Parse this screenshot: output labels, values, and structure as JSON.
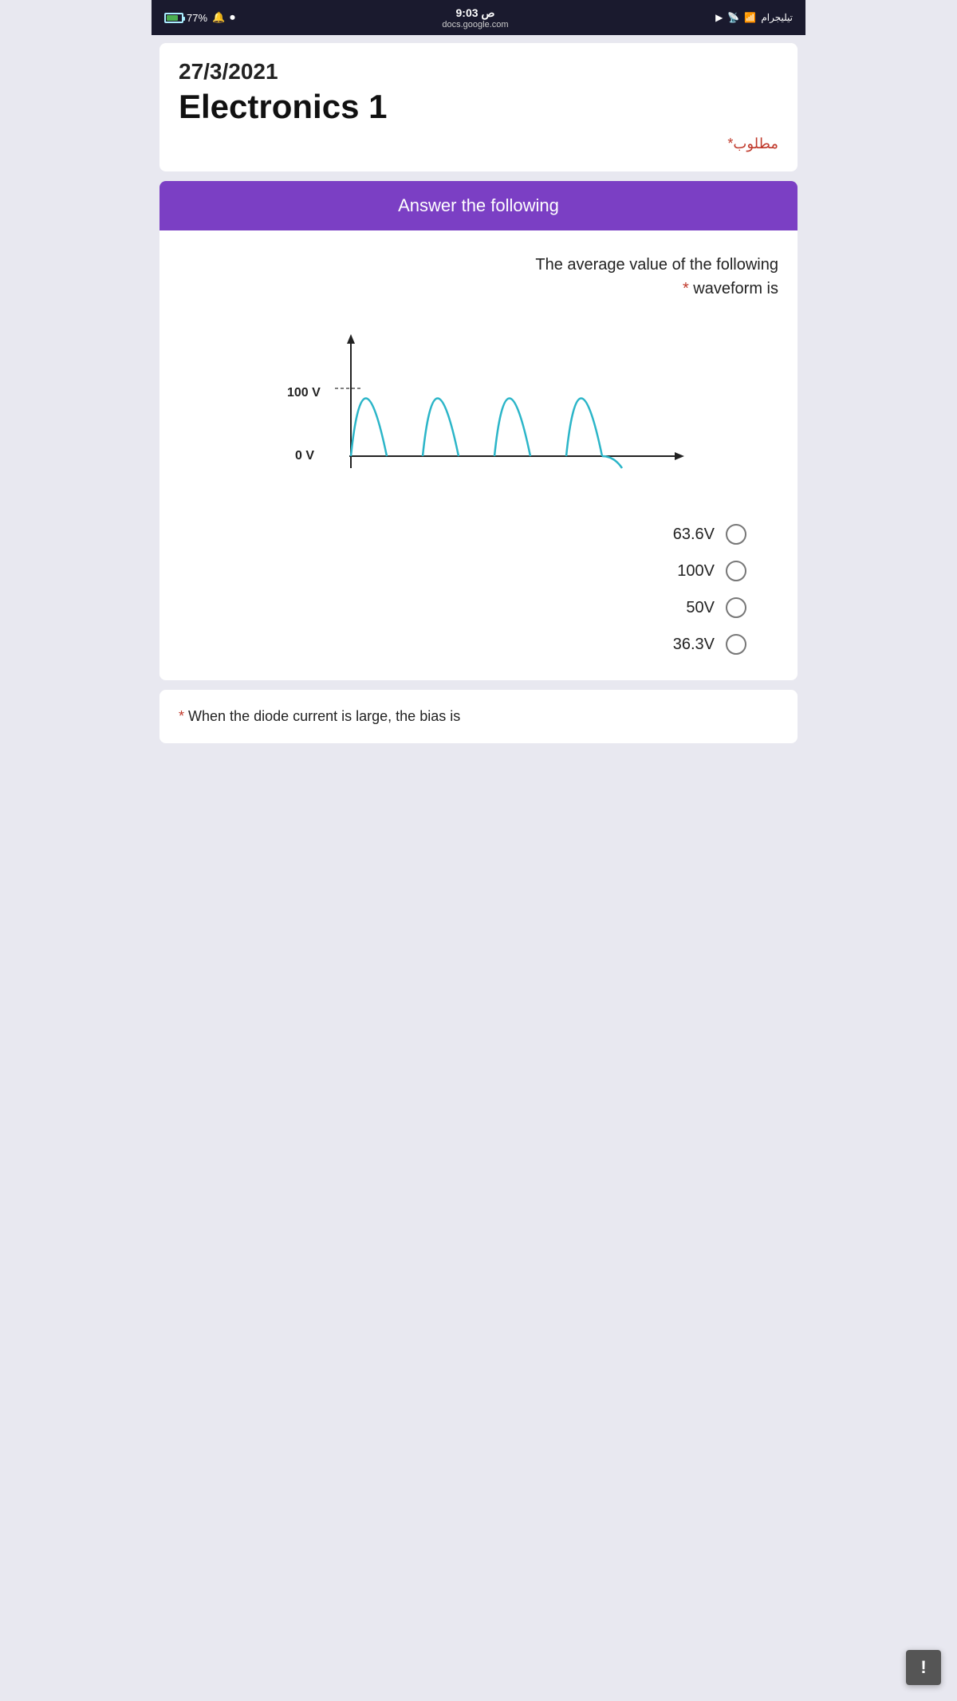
{
  "statusBar": {
    "battery": "77%",
    "time": "9:03 ص",
    "url": "docs.google.com",
    "networkLabel": "تيليجرام",
    "lockIcon": "🔒"
  },
  "headerCard": {
    "date": "27/3/2021",
    "title": "Electronics 1",
    "required": "مطلوب*"
  },
  "section": {
    "headerLabel": "Answer the following"
  },
  "question1": {
    "text": "The average value of the following",
    "requiredStar": "*",
    "waveformText": "waveform is",
    "voltageLabel": "100 V",
    "zeroLabel": "0 V",
    "options": [
      {
        "label": "63.6V"
      },
      {
        "label": "100V"
      },
      {
        "label": "50V"
      },
      {
        "label": "36.3V"
      }
    ]
  },
  "question2": {
    "requiredStar": "*",
    "text": "When the diode current is large, the bias is"
  },
  "fab": {
    "icon": "!"
  }
}
